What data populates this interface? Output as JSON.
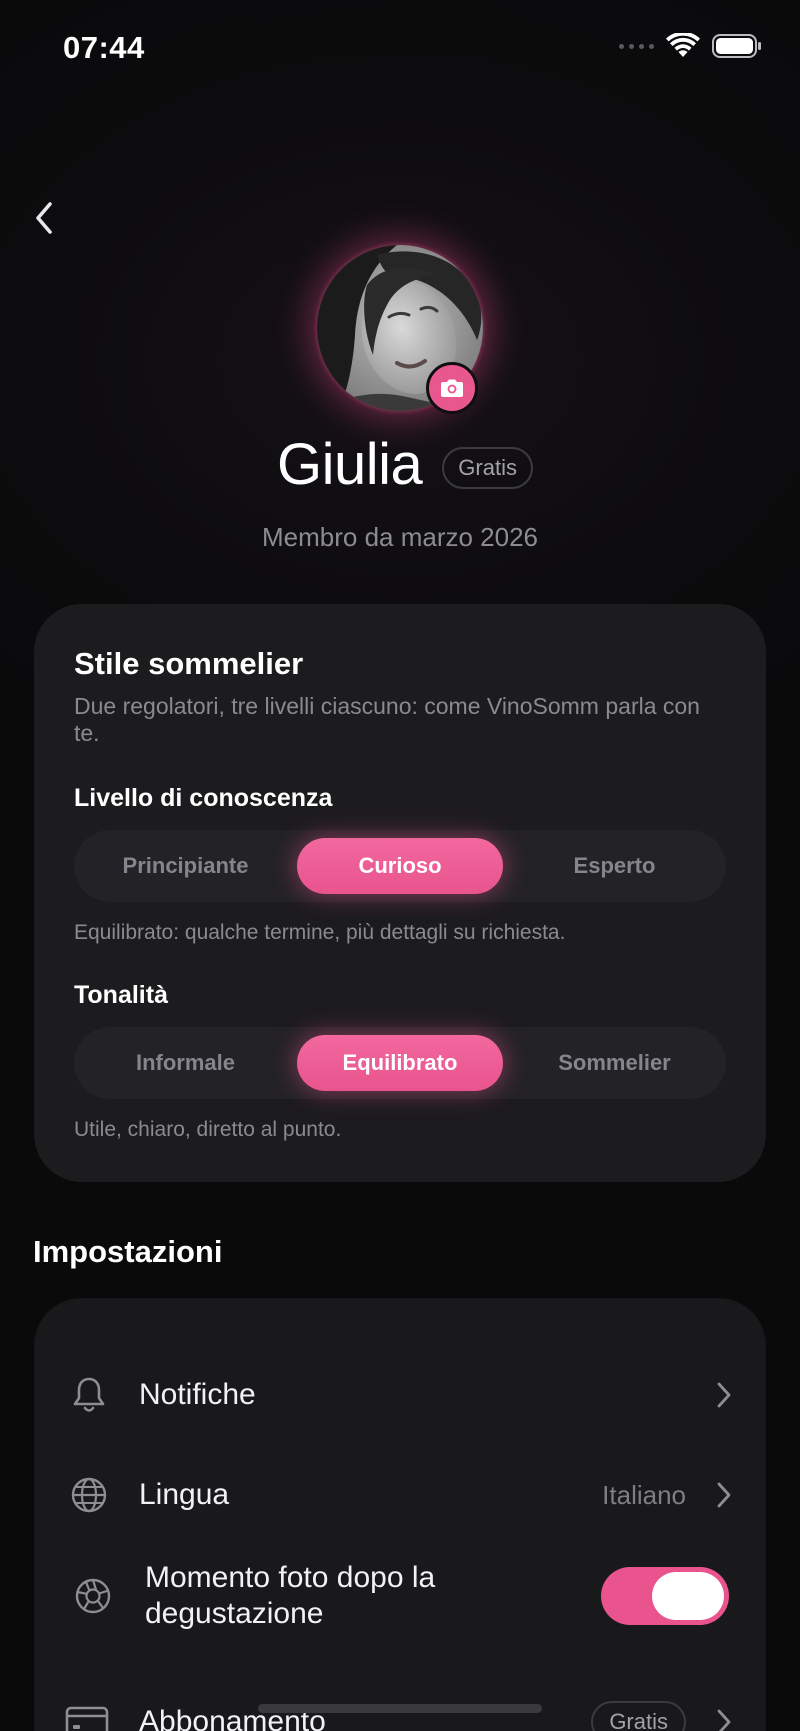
{
  "status_bar": {
    "time": "07:44"
  },
  "profile": {
    "name": "Giulia",
    "plan_badge": "Gratis",
    "member_since": "Membro da marzo 2026"
  },
  "style_card": {
    "title": "Stile sommelier",
    "subtitle": "Due regolatori, tre livelli ciascuno: come VinoSomm parla con te.",
    "knowledge": {
      "label": "Livello di conoscenza",
      "options": [
        "Principiante",
        "Curioso",
        "Esperto"
      ],
      "selected": "Curioso",
      "help": "Equilibrato: qualche termine, più dettagli su richiesta."
    },
    "tone": {
      "label": "Tonalità",
      "options": [
        "Informale",
        "Equilibrato",
        "Sommelier"
      ],
      "selected": "Equilibrato",
      "help": "Utile, chiaro, diretto al punto."
    }
  },
  "settings": {
    "title": "Impostazioni",
    "rows": [
      {
        "label": "Notifiche",
        "icon": "bell-icon"
      },
      {
        "label": "Lingua",
        "value": "Italiano",
        "icon": "globe-icon"
      },
      {
        "label": "Momento foto dopo la degustazione",
        "icon": "aperture-icon",
        "toggle_on": true
      },
      {
        "label": "Abbonamento",
        "badge": "Gratis",
        "icon": "credit-card-icon"
      }
    ]
  },
  "colors": {
    "accent": "#e9548e",
    "background": "#0a0a0b",
    "card": "#1c1b1e"
  }
}
